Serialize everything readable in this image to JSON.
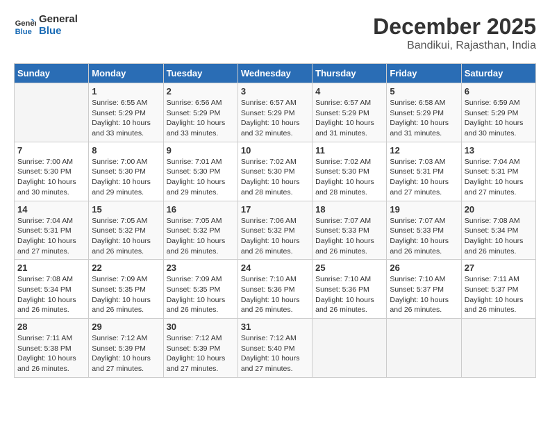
{
  "header": {
    "logo_line1": "General",
    "logo_line2": "Blue",
    "month_year": "December 2025",
    "location": "Bandikui, Rajasthan, India"
  },
  "days_of_week": [
    "Sunday",
    "Monday",
    "Tuesday",
    "Wednesday",
    "Thursday",
    "Friday",
    "Saturday"
  ],
  "weeks": [
    [
      {
        "day": "",
        "sunrise": "",
        "sunset": "",
        "daylight": ""
      },
      {
        "day": "1",
        "sunrise": "Sunrise: 6:55 AM",
        "sunset": "Sunset: 5:29 PM",
        "daylight": "Daylight: 10 hours and 33 minutes."
      },
      {
        "day": "2",
        "sunrise": "Sunrise: 6:56 AM",
        "sunset": "Sunset: 5:29 PM",
        "daylight": "Daylight: 10 hours and 33 minutes."
      },
      {
        "day": "3",
        "sunrise": "Sunrise: 6:57 AM",
        "sunset": "Sunset: 5:29 PM",
        "daylight": "Daylight: 10 hours and 32 minutes."
      },
      {
        "day": "4",
        "sunrise": "Sunrise: 6:57 AM",
        "sunset": "Sunset: 5:29 PM",
        "daylight": "Daylight: 10 hours and 31 minutes."
      },
      {
        "day": "5",
        "sunrise": "Sunrise: 6:58 AM",
        "sunset": "Sunset: 5:29 PM",
        "daylight": "Daylight: 10 hours and 31 minutes."
      },
      {
        "day": "6",
        "sunrise": "Sunrise: 6:59 AM",
        "sunset": "Sunset: 5:29 PM",
        "daylight": "Daylight: 10 hours and 30 minutes."
      }
    ],
    [
      {
        "day": "7",
        "sunrise": "Sunrise: 7:00 AM",
        "sunset": "Sunset: 5:30 PM",
        "daylight": "Daylight: 10 hours and 30 minutes."
      },
      {
        "day": "8",
        "sunrise": "Sunrise: 7:00 AM",
        "sunset": "Sunset: 5:30 PM",
        "daylight": "Daylight: 10 hours and 29 minutes."
      },
      {
        "day": "9",
        "sunrise": "Sunrise: 7:01 AM",
        "sunset": "Sunset: 5:30 PM",
        "daylight": "Daylight: 10 hours and 29 minutes."
      },
      {
        "day": "10",
        "sunrise": "Sunrise: 7:02 AM",
        "sunset": "Sunset: 5:30 PM",
        "daylight": "Daylight: 10 hours and 28 minutes."
      },
      {
        "day": "11",
        "sunrise": "Sunrise: 7:02 AM",
        "sunset": "Sunset: 5:30 PM",
        "daylight": "Daylight: 10 hours and 28 minutes."
      },
      {
        "day": "12",
        "sunrise": "Sunrise: 7:03 AM",
        "sunset": "Sunset: 5:31 PM",
        "daylight": "Daylight: 10 hours and 27 minutes."
      },
      {
        "day": "13",
        "sunrise": "Sunrise: 7:04 AM",
        "sunset": "Sunset: 5:31 PM",
        "daylight": "Daylight: 10 hours and 27 minutes."
      }
    ],
    [
      {
        "day": "14",
        "sunrise": "Sunrise: 7:04 AM",
        "sunset": "Sunset: 5:31 PM",
        "daylight": "Daylight: 10 hours and 27 minutes."
      },
      {
        "day": "15",
        "sunrise": "Sunrise: 7:05 AM",
        "sunset": "Sunset: 5:32 PM",
        "daylight": "Daylight: 10 hours and 26 minutes."
      },
      {
        "day": "16",
        "sunrise": "Sunrise: 7:05 AM",
        "sunset": "Sunset: 5:32 PM",
        "daylight": "Daylight: 10 hours and 26 minutes."
      },
      {
        "day": "17",
        "sunrise": "Sunrise: 7:06 AM",
        "sunset": "Sunset: 5:32 PM",
        "daylight": "Daylight: 10 hours and 26 minutes."
      },
      {
        "day": "18",
        "sunrise": "Sunrise: 7:07 AM",
        "sunset": "Sunset: 5:33 PM",
        "daylight": "Daylight: 10 hours and 26 minutes."
      },
      {
        "day": "19",
        "sunrise": "Sunrise: 7:07 AM",
        "sunset": "Sunset: 5:33 PM",
        "daylight": "Daylight: 10 hours and 26 minutes."
      },
      {
        "day": "20",
        "sunrise": "Sunrise: 7:08 AM",
        "sunset": "Sunset: 5:34 PM",
        "daylight": "Daylight: 10 hours and 26 minutes."
      }
    ],
    [
      {
        "day": "21",
        "sunrise": "Sunrise: 7:08 AM",
        "sunset": "Sunset: 5:34 PM",
        "daylight": "Daylight: 10 hours and 26 minutes."
      },
      {
        "day": "22",
        "sunrise": "Sunrise: 7:09 AM",
        "sunset": "Sunset: 5:35 PM",
        "daylight": "Daylight: 10 hours and 26 minutes."
      },
      {
        "day": "23",
        "sunrise": "Sunrise: 7:09 AM",
        "sunset": "Sunset: 5:35 PM",
        "daylight": "Daylight: 10 hours and 26 minutes."
      },
      {
        "day": "24",
        "sunrise": "Sunrise: 7:10 AM",
        "sunset": "Sunset: 5:36 PM",
        "daylight": "Daylight: 10 hours and 26 minutes."
      },
      {
        "day": "25",
        "sunrise": "Sunrise: 7:10 AM",
        "sunset": "Sunset: 5:36 PM",
        "daylight": "Daylight: 10 hours and 26 minutes."
      },
      {
        "day": "26",
        "sunrise": "Sunrise: 7:10 AM",
        "sunset": "Sunset: 5:37 PM",
        "daylight": "Daylight: 10 hours and 26 minutes."
      },
      {
        "day": "27",
        "sunrise": "Sunrise: 7:11 AM",
        "sunset": "Sunset: 5:37 PM",
        "daylight": "Daylight: 10 hours and 26 minutes."
      }
    ],
    [
      {
        "day": "28",
        "sunrise": "Sunrise: 7:11 AM",
        "sunset": "Sunset: 5:38 PM",
        "daylight": "Daylight: 10 hours and 26 minutes."
      },
      {
        "day": "29",
        "sunrise": "Sunrise: 7:12 AM",
        "sunset": "Sunset: 5:39 PM",
        "daylight": "Daylight: 10 hours and 27 minutes."
      },
      {
        "day": "30",
        "sunrise": "Sunrise: 7:12 AM",
        "sunset": "Sunset: 5:39 PM",
        "daylight": "Daylight: 10 hours and 27 minutes."
      },
      {
        "day": "31",
        "sunrise": "Sunrise: 7:12 AM",
        "sunset": "Sunset: 5:40 PM",
        "daylight": "Daylight: 10 hours and 27 minutes."
      },
      {
        "day": "",
        "sunrise": "",
        "sunset": "",
        "daylight": ""
      },
      {
        "day": "",
        "sunrise": "",
        "sunset": "",
        "daylight": ""
      },
      {
        "day": "",
        "sunrise": "",
        "sunset": "",
        "daylight": ""
      }
    ]
  ]
}
